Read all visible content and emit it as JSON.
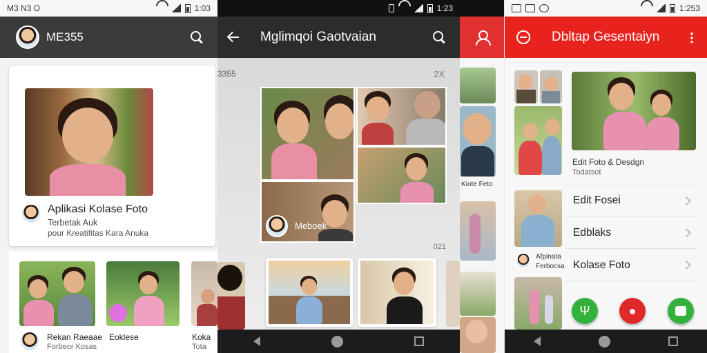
{
  "panel1": {
    "status": {
      "left": "M3 N3 O",
      "time": "1:03"
    },
    "appbar": {
      "title": "ME355"
    },
    "card": {
      "title": "Aplikasi Kolase Foto",
      "sub1": "Terbetak Auk",
      "sub2": "pour Kreatifitas Kara Anuka"
    },
    "bottom_items": [
      {
        "label": "Rekan Raeaae",
        "sub": "Forbeor Kosas"
      },
      {
        "label": "Eoklese",
        "sub": ""
      },
      {
        "label": "Koka",
        "sub": "Tota"
      }
    ]
  },
  "panel2": {
    "status": {
      "time": "1:23"
    },
    "appbar": {
      "title": "Mglimqoi Gaotvaian"
    },
    "label_left": "3355",
    "label_right": "2X",
    "badge_text": "Meboek",
    "row_label": "021"
  },
  "panel3": {
    "label": "Kiote Feto"
  },
  "panel4": {
    "status": {
      "time": "1:253"
    },
    "appbar": {
      "title": "Dbltap Gesentaiyn"
    },
    "hero_title": "Edit Foto & Desdgn",
    "hero_sub": "Todatsot",
    "side_label1": "Afpinata",
    "side_label2": "Ferbocsa",
    "menu": [
      {
        "label": "Edit Fosei"
      },
      {
        "label": "Edblaks"
      },
      {
        "label": "Kolase Foto"
      }
    ],
    "colors": {
      "accent": "#e8231e",
      "green": "#34b13c",
      "red": "#e02828"
    }
  }
}
